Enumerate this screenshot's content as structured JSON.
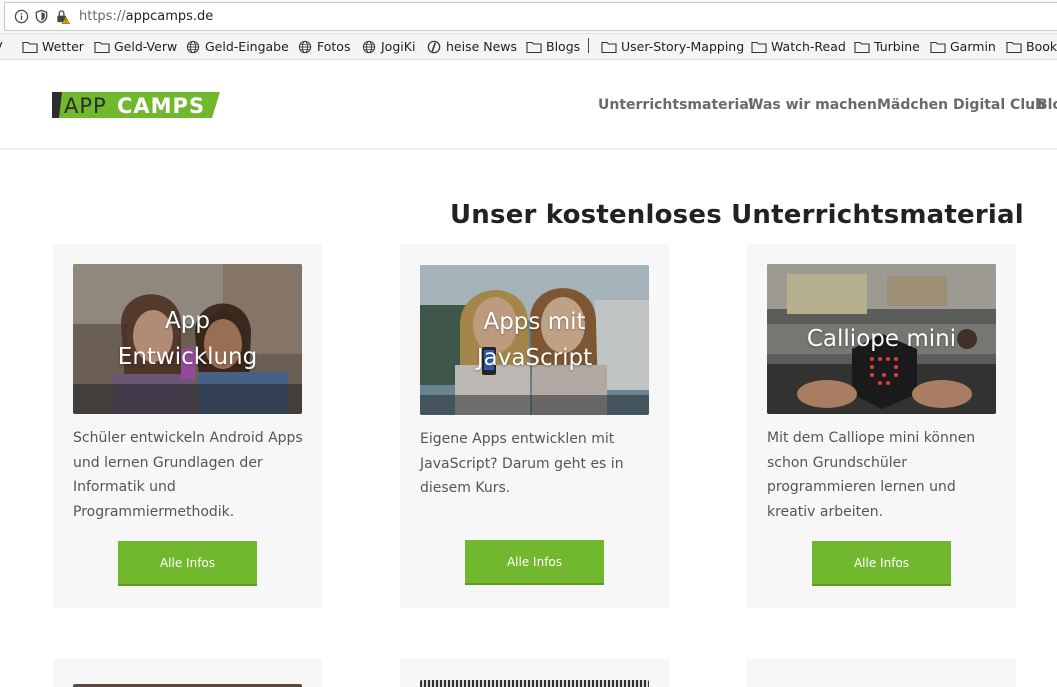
{
  "browser": {
    "url_protocol": "https://",
    "url_host": "appcamps.de"
  },
  "bookmarks": [
    {
      "label": "V",
      "icon": "folder-icon"
    },
    {
      "label": "Wetter",
      "icon": "folder-icon"
    },
    {
      "label": "Geld-Verw",
      "icon": "folder-icon"
    },
    {
      "label": "Geld-Eingabe",
      "icon": "globe-icon"
    },
    {
      "label": "Fotos",
      "icon": "globe-icon"
    },
    {
      "label": "JogiKi",
      "icon": "globe-icon"
    },
    {
      "label": "heise News",
      "icon": "heise-icon"
    },
    {
      "label": "Blogs",
      "icon": "folder-icon"
    },
    {
      "label": "User-Story-Mapping",
      "icon": "folder-icon"
    },
    {
      "label": "Watch-Read",
      "icon": "folder-icon"
    },
    {
      "label": "Turbine",
      "icon": "folder-icon"
    },
    {
      "label": "Garmin",
      "icon": "folder-icon"
    },
    {
      "label": "Books",
      "icon": "folder-icon"
    }
  ],
  "site": {
    "logo": {
      "part1": "APP",
      "part2": "CAMPS"
    },
    "nav": [
      "Unterrichtsmaterial",
      "Was wir machen",
      "Mädchen Digital Club",
      "Blog"
    ]
  },
  "main": {
    "title": "Unser kostenloses Unterrichtsmaterial",
    "cards": [
      {
        "image_title": "App Entwicklung",
        "description": "Schüler entwickeln Android Apps und lernen Grundlagen der Informatik und Programmiermethodik.",
        "button": "Alle Infos"
      },
      {
        "image_title": "Apps mit JavaScript",
        "description": "Eigene Apps entwicklen mit JavaScript? Darum geht es in diesem Kurs.",
        "button": "Alle Infos"
      },
      {
        "image_title": "Calliope mini",
        "description": "Mit dem Calliope mini können schon Grundschüler programmieren lernen und kreativ arbeiten.",
        "button": "Alle Infos"
      }
    ]
  },
  "colors": {
    "brand_green": "#72b82e",
    "logo_dark": "#2d2d2d",
    "nav_text": "#6a6a6a",
    "card_bg": "#f7f7f7"
  }
}
